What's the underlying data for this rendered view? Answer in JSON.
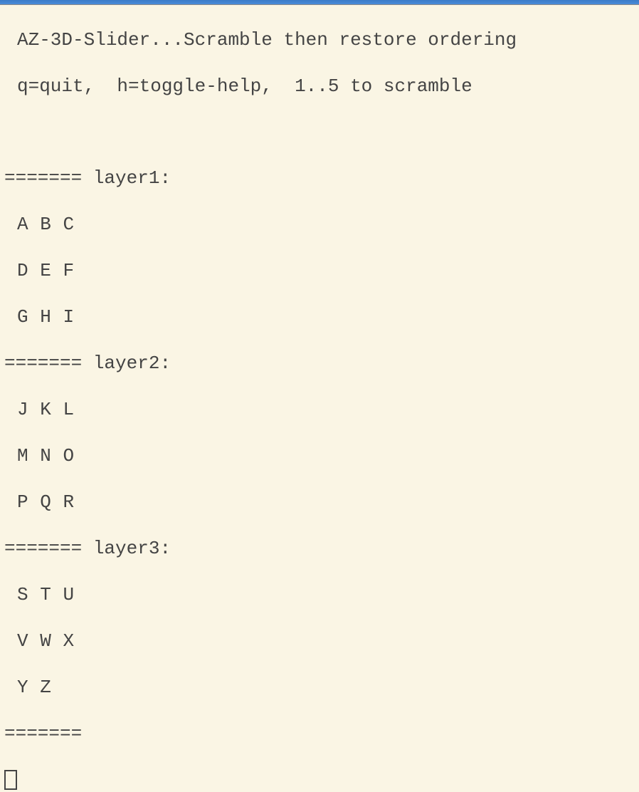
{
  "title": "AZ-3D-Slider...Scramble then restore ordering",
  "help": "q=quit,  h=toggle-help,  1..5 to scramble",
  "divider": "=======",
  "layers": [
    {
      "label": "layer1:",
      "rows": [
        "A B C",
        "D E F",
        "G H I"
      ]
    },
    {
      "label": "layer2:",
      "rows": [
        "J K L",
        "M N O",
        "P Q R"
      ]
    },
    {
      "label": "layer3:",
      "rows": [
        "S T U",
        "V W X",
        "Y Z"
      ]
    }
  ]
}
